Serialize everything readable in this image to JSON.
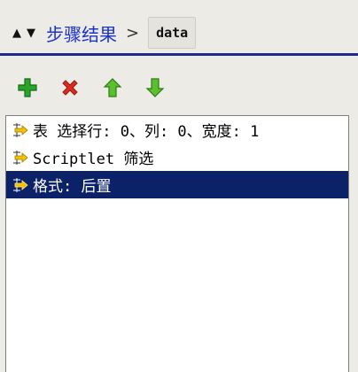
{
  "breadcrumb": {
    "nav_up": "▲",
    "nav_down": "▼",
    "parent": "步骤结果",
    "separator": ">",
    "current": "data"
  },
  "toolbar": {
    "add_icon": "plus-icon",
    "delete_icon": "close-icon",
    "move_up_icon": "arrow-up-icon",
    "move_down_icon": "arrow-down-icon"
  },
  "steps": [
    {
      "label": "表 选择行: 0、列: 0、宽度: 1",
      "icon": "step-arrow-icon",
      "selected": false
    },
    {
      "label": "Scriptlet 筛选",
      "icon": "step-arrow-icon",
      "selected": false
    },
    {
      "label": "格式: 后置",
      "icon": "step-arrow-icon",
      "selected": true
    }
  ],
  "colors": {
    "link": "#1c34c9",
    "accent": "#1f2b86",
    "selection": "#0b2268",
    "add": "#2aa52a",
    "delete": "#e02a1c",
    "arrows": "#5cbf2f"
  }
}
